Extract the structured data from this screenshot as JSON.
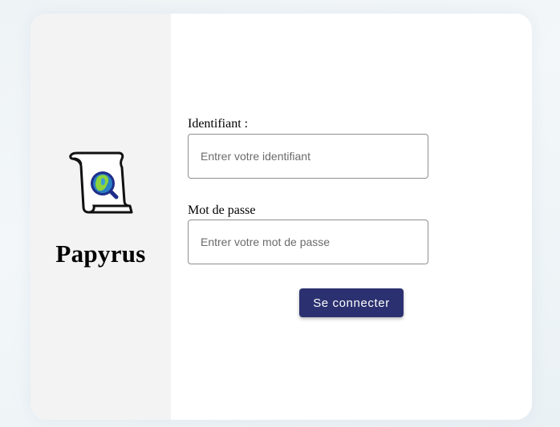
{
  "brand": {
    "name": "Papyrus",
    "logo_icon": "scroll-magnifier-icon"
  },
  "form": {
    "username_label": "Identifiant :",
    "username_placeholder": "Entrer votre identifiant",
    "username_value": "",
    "password_label": "Mot de passe",
    "password_placeholder": "Entrer votre mot de passe",
    "password_value": "",
    "submit_label": "Se connecter"
  },
  "colors": {
    "accent": "#2b3170",
    "left_panel": "#f3f3f3",
    "background": "#eef3f6"
  }
}
